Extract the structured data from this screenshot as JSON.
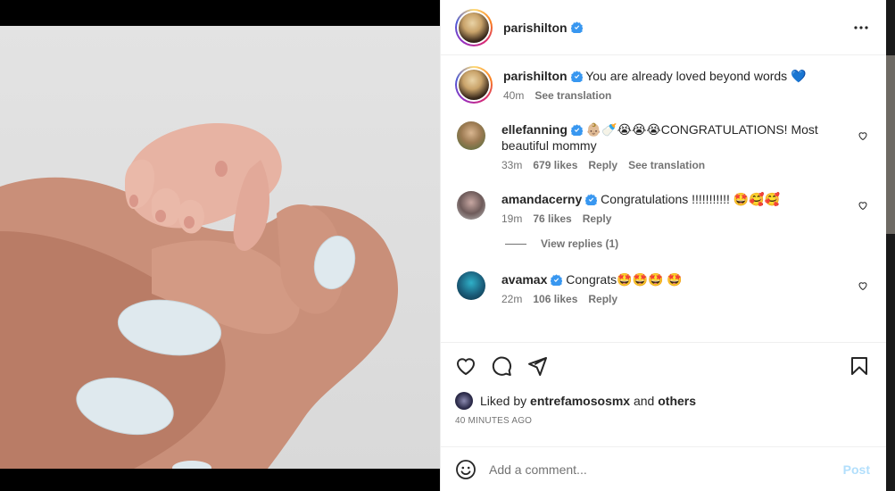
{
  "post": {
    "author": "parishilton",
    "caption": "You are already loved beyond words 💙",
    "caption_age": "40m",
    "see_translation": "See translation",
    "more_label": "•••"
  },
  "comments": [
    {
      "username": "ellefanning",
      "text": "👶🏼🍼😭😭😭CONGRATULATIONS! Most beautiful mommy",
      "age": "33m",
      "likes": "679 likes",
      "reply": "Reply",
      "see_translation": "See translation"
    },
    {
      "username": "amandacerny",
      "text": "Congratulations !!!!!!!!!!! 🤩🥰🥰",
      "age": "19m",
      "likes": "76 likes",
      "reply": "Reply",
      "view_replies": "View replies (1)"
    },
    {
      "username": "avamax",
      "text": "Congrats🤩🤩🤩 🤩",
      "age": "22m",
      "likes": "106 likes",
      "reply": "Reply"
    }
  ],
  "likes": {
    "prefix": "Liked by",
    "user": "entrefamososmx",
    "and": "and",
    "others": "others"
  },
  "timestamp": "40 MINUTES AGO",
  "add_comment": {
    "placeholder": "Add a comment...",
    "post_label": "Post"
  },
  "colors": {
    "verified": "#3897f0",
    "post_disabled": "#b2dffc",
    "nail": "#dfe9ee"
  },
  "icons": {
    "verified": "verified-badge-icon",
    "heart": "heart-icon",
    "comment": "comment-icon",
    "share": "share-icon",
    "bookmark": "bookmark-icon",
    "emoji": "emoji-icon",
    "more": "more-options-icon"
  }
}
